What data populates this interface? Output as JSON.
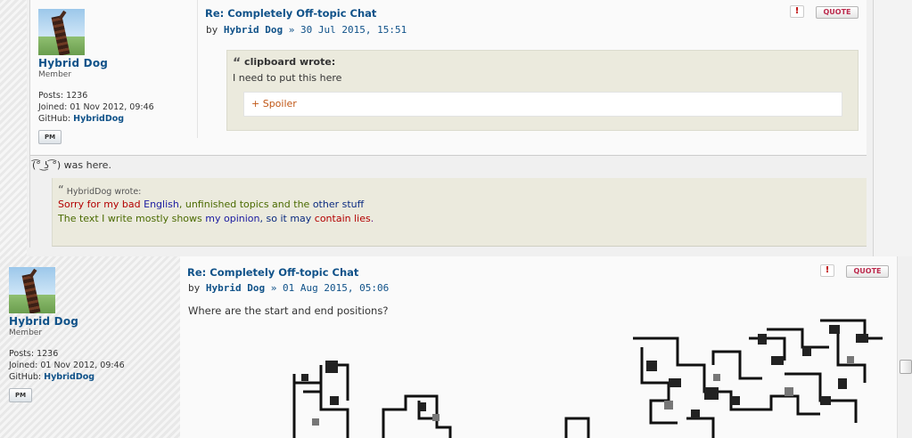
{
  "posts": [
    {
      "title": "Re: Completely Off-topic Chat",
      "by": "by",
      "author": "Hybrid Dog",
      "sep": "»",
      "date": "30 Jul 2015, 15:51",
      "report_icon": "!",
      "quote_label": "QUOTE",
      "quote": {
        "author": "clipboard wrote:",
        "text": "I need to put this here",
        "spoiler": "+ Spoiler"
      }
    },
    {
      "title": "Re: Completely Off-topic Chat",
      "by": "by",
      "author": "Hybrid Dog",
      "sep": "»",
      "date": "01 Aug 2015, 05:06",
      "report_icon": "!",
      "quote_label": "QUOTE",
      "body": "Where are the start and end positions?"
    }
  ],
  "profile": {
    "username": "Hybrid Dog",
    "rank": "Member",
    "posts_label": "Posts:",
    "posts": "1236",
    "joined_label": "Joined:",
    "joined": "01 Nov 2012, 09:46",
    "github_label": "GitHub:",
    "github": "HybridDog",
    "pm_label": "PM"
  },
  "signature": {
    "line": "(͡° ͜ʖ ͡°) was here.",
    "quote_head": "HybridDog wrote:",
    "l1_a": "Sorry for my bad ",
    "l1_b": "English",
    "l1_c": ", unfinished topics and the ",
    "l1_d": "other stuff",
    "l2_a": "The text I write mostly shows ",
    "l2_b": "my opinion",
    "l2_c": ", so it may ",
    "l2_d": "contain lies",
    "l2_e": "."
  },
  "colors": {
    "link": "#105289",
    "quote_bg": "#ebeadd",
    "spoiler": "#c05716"
  }
}
